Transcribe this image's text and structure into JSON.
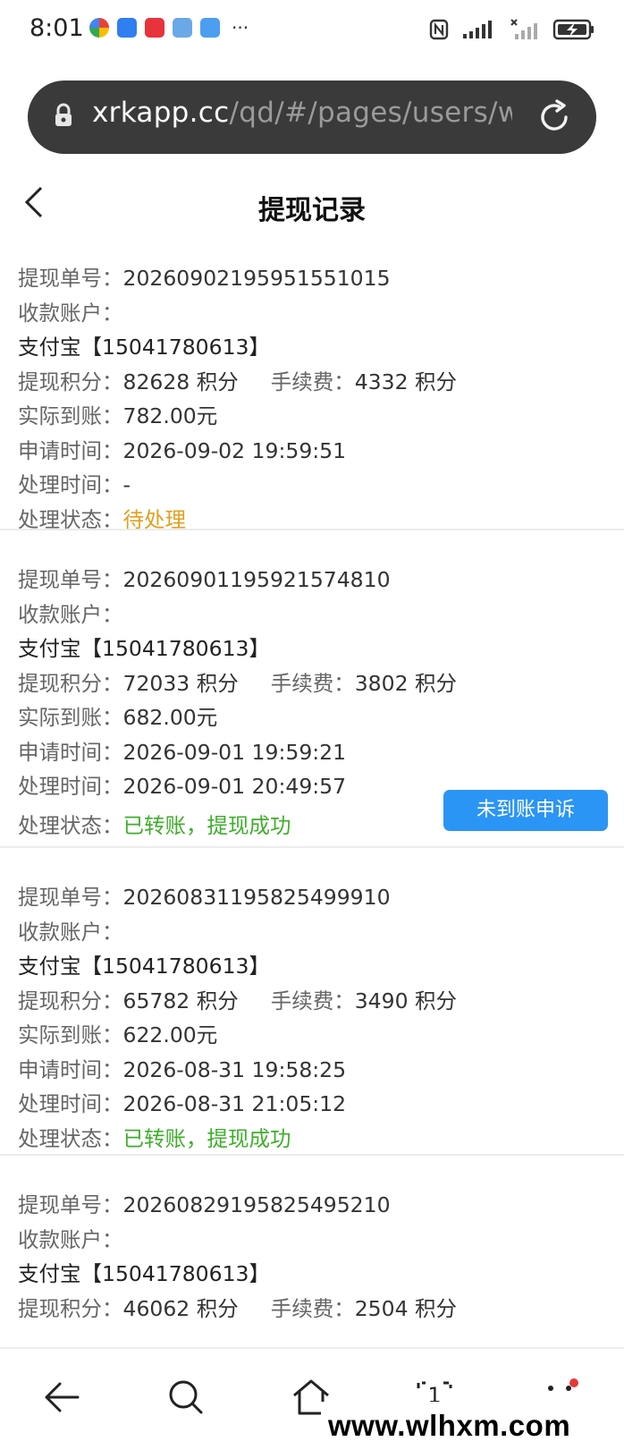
{
  "status_bar": {
    "time": "8:01",
    "more_label": "···"
  },
  "browser": {
    "url_host": "xrkapp.cc",
    "url_path": "/qd/#/pages/users/wi"
  },
  "page": {
    "title": "提现记录"
  },
  "labels": {
    "order_no": "提现单号：",
    "account": "收款账户：",
    "points": "提现积分：",
    "fee": "手续费：",
    "actual": "实际到账：",
    "apply_time": "申请时间：",
    "process_time": "处理时间：",
    "status": "处理状态："
  },
  "records": [
    {
      "order_no": "20260902195951551015",
      "account": "支付宝【15041780613】",
      "points": "82628 积分",
      "fee": "4332 积分",
      "actual": "782.00元",
      "apply_time": "2026-09-02 19:59:51",
      "process_time": "-",
      "status": "待处理"
    },
    {
      "order_no": "20260901195921574810",
      "account": "支付宝【15041780613】",
      "points": "72033 积分",
      "fee": "3802 积分",
      "actual": "682.00元",
      "apply_time": "2026-09-01 19:59:21",
      "process_time": "2026-09-01 20:49:57",
      "status": "已转账，提现成功",
      "appeal_button": "未到账申诉"
    },
    {
      "order_no": "20260831195825499910",
      "account": "支付宝【15041780613】",
      "points": "65782 积分",
      "fee": "3490 积分",
      "actual": "622.00元",
      "apply_time": "2026-08-31 19:58:25",
      "process_time": "2026-08-31 21:05:12",
      "status": "已转账，提现成功"
    },
    {
      "order_no": "20260829195825495210",
      "account": "支付宝【15041780613】",
      "points": "46062 积分",
      "fee": "2504 积分"
    }
  ],
  "bottom_nav": {
    "tabs_count": "1"
  },
  "watermark": "www.wlhxm.com",
  "colors": {
    "pending": "#e0a020",
    "success": "#3fae2c",
    "appeal_button": "#2b95f5"
  }
}
